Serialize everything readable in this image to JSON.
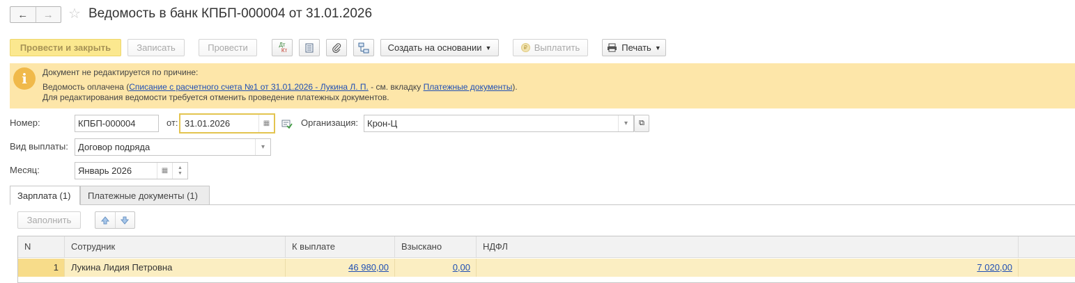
{
  "window": {
    "title": "Ведомость в банк КПБП-000004 от 31.01.2026",
    "back_icon": "←",
    "forward_icon": "→",
    "favorite_icon": "☆"
  },
  "toolbar": {
    "post_and_close": "Провести и закрыть",
    "write": "Записать",
    "post": "Провести",
    "dt_kt_top": "Дт",
    "dt_kt_bottom": "Кт",
    "create_based_on": "Создать на основании",
    "pay": "Выплатить",
    "print": "Печать"
  },
  "banner": {
    "line1": "Документ не редактируется по причине:",
    "line2_prefix": "Ведомость оплачена (",
    "line2_link": "Списание с расчетного счета №1 от 31.01.2026 - Лукина Л. П.",
    "line2_mid": " - см. вкладку ",
    "line2_link2": "Платежные документы",
    "line2_suffix": ").",
    "line3": "Для редактирования ведомости требуется отменить проведение платежных документов."
  },
  "form": {
    "number_label": "Номер:",
    "number_value": "КПБП-000004",
    "date_label": "от:",
    "date_value": "31.01.2026",
    "org_label": "Организация:",
    "org_value": "Крон-Ц",
    "payment_type_label": "Вид выплаты:",
    "payment_type_value": "Договор подряда",
    "month_label": "Месяц:",
    "month_value": "Январь 2026"
  },
  "tabs": [
    {
      "label": "Зарплата (1)",
      "active": true
    },
    {
      "label": "Платежные документы (1)",
      "active": false
    }
  ],
  "table_toolbar": {
    "fill": "Заполнить"
  },
  "table": {
    "columns": [
      "N",
      "Сотрудник",
      "К выплате",
      "Взыскано",
      "НДФЛ"
    ],
    "rows": [
      {
        "n": "1",
        "employee": "Лукина Лидия Петровна",
        "to_pay": "46 980,00",
        "withheld": "0,00",
        "ndfl": "7 020,00"
      }
    ]
  },
  "colors": {
    "banner_bg": "#fde6a9",
    "primary_button": "#fbe88f",
    "selected_row": "#fbeec2",
    "link": "#1f4fb4"
  }
}
